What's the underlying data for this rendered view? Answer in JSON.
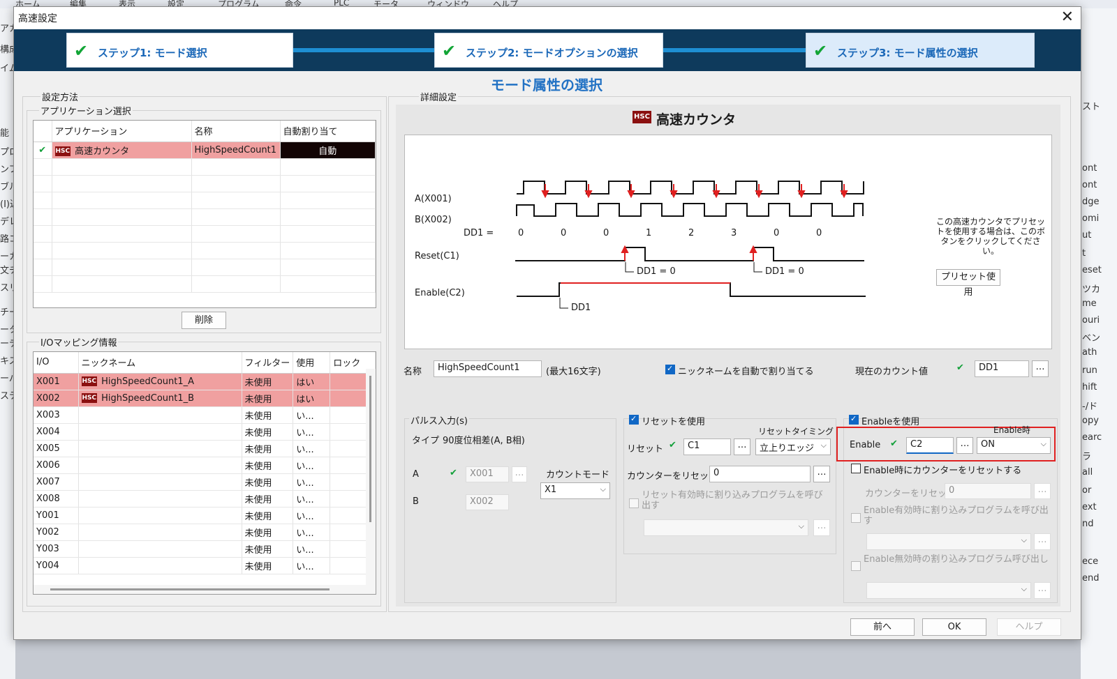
{
  "background": {
    "menu": [
      "ホーム",
      "編集",
      "表示",
      "設定",
      "プログラム",
      "命令",
      "PLC",
      "モータ",
      "ウィンドウ",
      "ヘルプ"
    ],
    "left_fragments": [
      "アカ",
      "構成",
      "イム",
      "能",
      "プロ",
      "ンフ",
      "ブル",
      "(I)込",
      "デレ",
      "路コ",
      "ーカ",
      "文チ",
      "スリ",
      "チー",
      "ータ",
      "ーデ",
      "キス",
      "ーバ",
      "ステ"
    ],
    "right_fragments": [
      "スト",
      "ont",
      "ont",
      "dge",
      "omi",
      "ut",
      "t",
      "eset",
      "ツカ",
      "me",
      "ouri",
      "ベン",
      "ath",
      "run",
      "hift",
      "-/ド",
      "opy",
      "earc",
      "ラ",
      "all",
      "or",
      "ext",
      "nd",
      "ece",
      "end"
    ]
  },
  "dialog": {
    "title": "高速設定",
    "close_glyph": "✕",
    "steps": [
      {
        "label": "ステップ1:  モード選択"
      },
      {
        "label": "ステップ2:  モードオプションの選択"
      },
      {
        "label": "ステップ3:  モード属性の選択"
      }
    ],
    "header": "モード属性の選択"
  },
  "left": {
    "method_title": "設定方法",
    "app_select_title": "アプリケーション選択",
    "app_table": {
      "headers": [
        "アプリケーション",
        "名称",
        "自動割り当て"
      ],
      "rows": [
        {
          "app": "高速カウンタ",
          "name": "HighSpeedCount1",
          "auto": "自動"
        }
      ]
    },
    "delete_button": "削除",
    "io_title": "I/Oマッピング情報",
    "io_table": {
      "headers": [
        "I/O",
        "ニックネーム",
        "フィルター",
        "使用",
        "ロック"
      ],
      "rows": [
        {
          "io": "X001",
          "nick": "HighSpeedCount1_A",
          "filter": "未使用",
          "use": "はい",
          "hsc": true
        },
        {
          "io": "X002",
          "nick": "HighSpeedCount1_B",
          "filter": "未使用",
          "use": "はい",
          "hsc": true
        },
        {
          "io": "X003",
          "nick": "",
          "filter": "未使用",
          "use": "い...",
          "hsc": false
        },
        {
          "io": "X004",
          "nick": "",
          "filter": "未使用",
          "use": "い...",
          "hsc": false
        },
        {
          "io": "X005",
          "nick": "",
          "filter": "未使用",
          "use": "い...",
          "hsc": false
        },
        {
          "io": "X006",
          "nick": "",
          "filter": "未使用",
          "use": "い...",
          "hsc": false
        },
        {
          "io": "X007",
          "nick": "",
          "filter": "未使用",
          "use": "い...",
          "hsc": false
        },
        {
          "io": "X008",
          "nick": "",
          "filter": "未使用",
          "use": "い...",
          "hsc": false
        },
        {
          "io": "Y001",
          "nick": "",
          "filter": "未使用",
          "use": "い...",
          "hsc": false
        },
        {
          "io": "Y002",
          "nick": "",
          "filter": "未使用",
          "use": "い...",
          "hsc": false
        },
        {
          "io": "Y003",
          "nick": "",
          "filter": "未使用",
          "use": "い...",
          "hsc": false
        },
        {
          "io": "Y004",
          "nick": "",
          "filter": "未使用",
          "use": "い...",
          "hsc": false
        }
      ]
    }
  },
  "detail": {
    "title": "詳細設定",
    "hsc_badge": "HSC",
    "panel_title": "高速カウンタ",
    "diagram": {
      "signal_a": "A(X001)",
      "signal_b": "B(X002)",
      "dd1_label": "DD1 =",
      "counts": [
        "0",
        "0",
        "0",
        "1",
        "2",
        "3",
        "0",
        "0"
      ],
      "reset": "Reset(C1)",
      "enable": "Enable(C2)",
      "reset_note_1": "DD1 = 0",
      "reset_note_2": "DD1 = 0",
      "enable_note": "DD1",
      "preset_note": "この高速カウンタでプリセットを使用する場合は、このボタンをクリックしてください。",
      "preset_button": "プリセット使用"
    },
    "name_label": "名称",
    "name_value": "HighSpeedCount1",
    "name_max": "(最大16文字)",
    "auto_nick": "ニックネームを自動で割り当てる",
    "current_count_label": "現在のカウント値",
    "current_count_value": "DD1",
    "pulse": {
      "title": "パルス入力(s)",
      "type_label": "タイプ",
      "type_value": "90度位相差(A, B相)",
      "a_label": "A",
      "a_value": "X001",
      "b_label": "B",
      "b_value": "X002",
      "count_mode_label": "カウントモード",
      "count_mode_value": "X1"
    },
    "reset": {
      "use_label": "リセットを使用",
      "timing_label": "リセットタイミング",
      "reset_label": "リセット",
      "reset_value": "C1",
      "timing_value": "立上りエッジ",
      "counter_reset_label": "カウンターをリセット",
      "counter_reset_value": "0",
      "interrupt_label": "リセット有効時に割り込みプログラムを呼び出す"
    },
    "enable": {
      "use_label": "Enableを使用",
      "when_label": "Enable時",
      "enable_label": "Enable",
      "enable_value": "C2",
      "when_value": "ON",
      "reset_on_enable": "Enable時にカウンターをリセットする",
      "counter_reset_label": "カウンターをリセット",
      "counter_reset_value": "0",
      "interrupt_on": "Enable有効時に割り込みプログラムを呼び出す",
      "interrupt_off": "Enable無効時の割り込みプログラム呼び出し"
    }
  },
  "buttons": {
    "prev": "前へ",
    "ok": "OK",
    "help": "ヘルプ"
  },
  "colors": {
    "accent": "#1e8fd3",
    "selected_row": "#f0a0a0",
    "highlight": "#e02020",
    "step_bar": "#0e3a5c"
  }
}
